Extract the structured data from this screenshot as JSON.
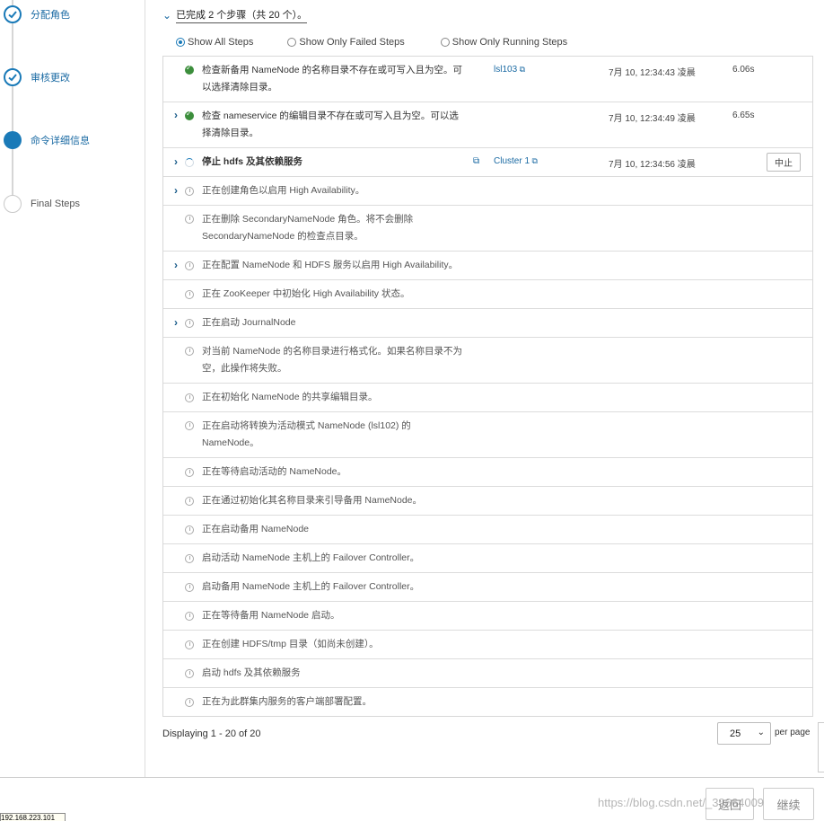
{
  "wizard": {
    "steps": [
      {
        "label": "分配角色",
        "state": "done"
      },
      {
        "label": "审核更改",
        "state": "done"
      },
      {
        "label": "命令详细信息",
        "state": "active"
      },
      {
        "label": "Final Steps",
        "state": "todo"
      }
    ]
  },
  "summary": {
    "text": "已完成 2 个步骤（共 20 个）。"
  },
  "filters": [
    {
      "label": "Show All Steps",
      "selected": true
    },
    {
      "label": "Show Only Failed Steps",
      "selected": false
    },
    {
      "label": "Show Only Running Steps",
      "selected": false
    }
  ],
  "steps": [
    {
      "desc": "检查新备用 NameNode 的名称目录不存在或可写入且为空。可以选择清除目录。",
      "host": "lsl103",
      "time": "7月 10, 12:34:43 凌晨",
      "duration": "6.06s",
      "status": "done",
      "expandable": false
    },
    {
      "desc": "检查 nameservice 的编辑目录不存在或可写入且为空。可以选择清除目录。",
      "time": "7月 10, 12:34:49 凌晨",
      "duration": "6.65s",
      "status": "done",
      "expandable": true
    },
    {
      "desc": "停止 hdfs 及其依赖服务",
      "host": "Cluster 1",
      "time": "7月 10, 12:34:56 凌晨",
      "action": "中止",
      "status": "running",
      "expandable": true
    },
    {
      "desc": "正在创建角色以启用 High Availability。",
      "status": "pending",
      "expandable": true
    },
    {
      "desc": "正在删除 SecondaryNameNode 角色。将不会删除 SecondaryNameNode 的检查点目录。",
      "status": "pending",
      "expandable": false
    },
    {
      "desc": "正在配置 NameNode 和 HDFS 服务以启用 High Availability。",
      "status": "pending",
      "expandable": true
    },
    {
      "desc": "正在 ZooKeeper 中初始化 High Availability 状态。",
      "status": "pending",
      "expandable": false
    },
    {
      "desc": "正在启动 JournalNode",
      "status": "pending",
      "expandable": true
    },
    {
      "desc": "对当前 NameNode 的名称目录进行格式化。如果名称目录不为空，此操作将失败。",
      "status": "pending",
      "expandable": false
    },
    {
      "desc": "正在初始化 NameNode 的共享编辑目录。",
      "status": "pending",
      "expandable": false
    },
    {
      "desc": "正在启动将转换为活动模式 NameNode (lsl102) 的 NameNode。",
      "status": "pending",
      "expandable": false
    },
    {
      "desc": "正在等待启动活动的 NameNode。",
      "status": "pending",
      "expandable": false
    },
    {
      "desc": "正在通过初始化其名称目录来引导备用 NameNode。",
      "status": "pending",
      "expandable": false
    },
    {
      "desc": "正在启动备用 NameNode",
      "status": "pending",
      "expandable": false
    },
    {
      "desc": "启动活动 NameNode 主机上的 Failover Controller。",
      "status": "pending",
      "expandable": false
    },
    {
      "desc": "启动备用 NameNode 主机上的 Failover Controller。",
      "status": "pending",
      "expandable": false
    },
    {
      "desc": "正在等待备用 NameNode 启动。",
      "status": "pending",
      "expandable": false
    },
    {
      "desc": "正在创建 HDFS/tmp 目录（如尚未创建）。",
      "status": "pending",
      "expandable": false
    },
    {
      "desc": "启动 hdfs 及其依赖服务",
      "status": "pending",
      "expandable": false
    },
    {
      "desc": "正在为此群集内服务的客户端部署配置。",
      "status": "pending",
      "expandable": false
    }
  ],
  "pagination": {
    "display_text": "Displaying 1 - 20 of 20",
    "page_size": "25",
    "per_page_label": "per page"
  },
  "buttons": {
    "back": "返回",
    "next": "继续"
  },
  "watermark": "https://blog.csdn.net/_39664009",
  "status_tip": "192.168.223.101",
  "colors": {
    "accent": "#1a7ab8",
    "success": "#3c8e3c",
    "link": "#1a6aa3"
  }
}
